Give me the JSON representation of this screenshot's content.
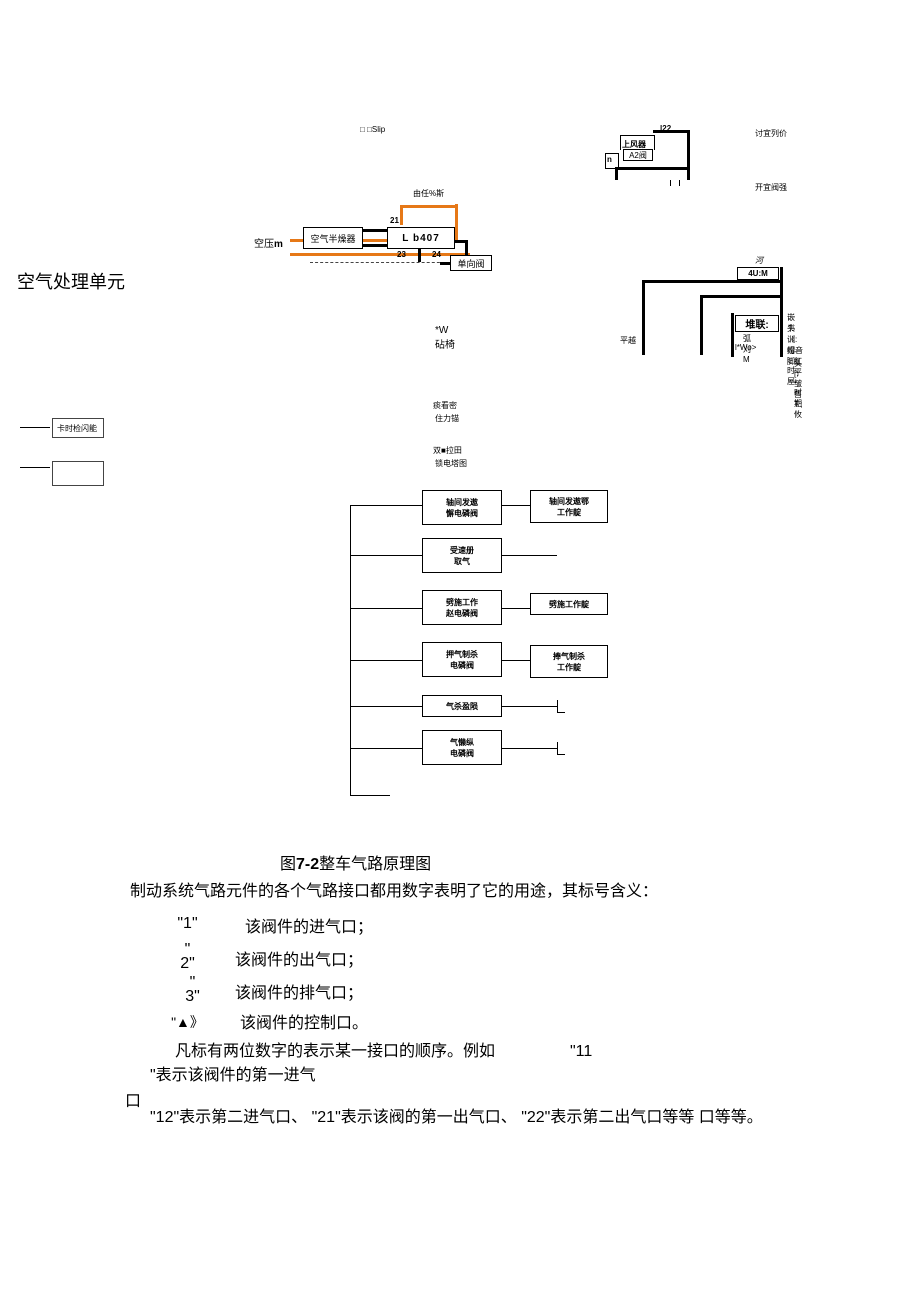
{
  "diagram": {
    "slip_label": "□ □Slip",
    "air_filter": "空气半燥器",
    "lb407": "L b407",
    "single_valve": "单向阀",
    "air_compressor_prefix": "空压",
    "air_compressor_suffix": "m",
    "air_processing_unit": "空气处理单元",
    "by_ft_percent": "由任%斯",
    "upper_wind": "上风器",
    "a2valve": "A2阀",
    "port21": "21",
    "port22": "|22",
    "port23": "23",
    "port24": "24",
    "body_height_adj": "讨宜列价",
    "body_height_reduce": "开宜阀强",
    "pressure_note": "河废",
    "4um": "4U:M",
    "w_drill": "*W",
    "drill_chair": "砧椅",
    "flat_over": "平越",
    "dual_connect1": "堆联:",
    "dual_m": "弧刈M",
    "dual_wo": "l*Wo>",
    "right_note1": "嵌书训帽i:时屋",
    "right_note2": "头 《:纷音脚》",
    "right_note3": "-紅平•时期攸",
    "right_note4": "头 [;皱售T:;",
    "pain_label": "痰看密",
    "pressure_locker": "住力锚",
    "dual_solenoid": "双■拉田",
    "lock_coil": "锁电塔图",
    "card_lock": "卡时检闪能",
    "ladder": {
      "box1a": "轴间发遨",
      "box1b": "懈电磷阀",
      "box1c": "轴间发遨鄂",
      "box1d": "工作靛",
      "box2a": "受速册",
      "box2b": "取气",
      "box3a": "劈施工作",
      "box3b": "赵电磷阀",
      "box3c": "劈施工作靛",
      "box4a": "押气制杀",
      "box4b": "电磷阀",
      "box4c": "捧气制杀",
      "box4d": "工作靛",
      "box5a": "气杀盈陨",
      "box6a": "气懒纵",
      "box6b": "电磷阀"
    }
  },
  "caption": "图7-2整车气路原理图",
  "intro": "制动系统气路元件的各个气路接口都用数字表明了它的用途，其标号含义：",
  "ports": {
    "p1": {
      "num": "\"1\"",
      "desc": "该阀件的进气口；"
    },
    "p2": {
      "num": "\"\n2\"",
      "desc": "该阀件的出气口；"
    },
    "p3": {
      "num": "\"\n3\"",
      "desc": "该阀件的排气口；"
    },
    "p4": {
      "num": "\"▲》",
      "desc": "该阀件的控制口。"
    }
  },
  "footer": {
    "line1a": "凡标有两位数字的表示某一接口的顺序。例如",
    "line1b": "\"11",
    "line2": "\"表示该阀件的第一进气",
    "line3": "口",
    "line4": "\"12\"表示第二进气口、 \"21\"表示该阀的第一出气口、 \"22\"表示第二出气口等等 口等等。"
  }
}
